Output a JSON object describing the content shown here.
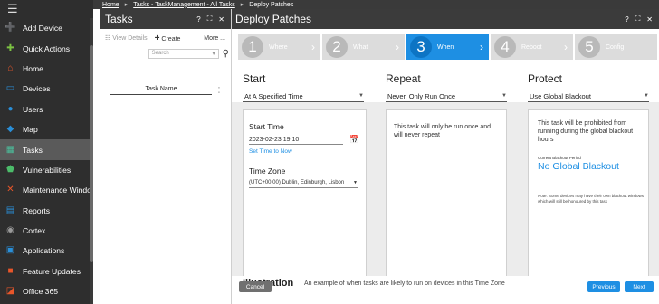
{
  "nav": {
    "items": [
      {
        "label": "Add Device",
        "icon": "add-device-icon",
        "glyph": "➕",
        "color": "#7cc243"
      },
      {
        "label": "Quick Actions",
        "icon": "quick-actions-icon",
        "glyph": "✚",
        "color": "#7cc243"
      },
      {
        "label": "Home",
        "icon": "home-icon",
        "glyph": "⌂",
        "color": "#e8562a"
      },
      {
        "label": "Devices",
        "icon": "devices-icon",
        "glyph": "▭",
        "color": "#2a8fd8"
      },
      {
        "label": "Users",
        "icon": "users-icon",
        "glyph": "●",
        "color": "#2a8fd8"
      },
      {
        "label": "Map",
        "icon": "map-icon",
        "glyph": "◆",
        "color": "#2a8fd8"
      },
      {
        "label": "Tasks",
        "icon": "tasks-icon",
        "glyph": "▦",
        "color": "#4cbc9a"
      },
      {
        "label": "Vulnerabilities",
        "icon": "vulnerabilities-icon",
        "glyph": "⬟",
        "color": "#4cbc6a"
      },
      {
        "label": "Maintenance Windows",
        "icon": "maintenance-icon",
        "glyph": "✕",
        "color": "#e8562a"
      },
      {
        "label": "Reports",
        "icon": "reports-icon",
        "glyph": "▤",
        "color": "#2a8fd8"
      },
      {
        "label": "Cortex",
        "icon": "cortex-icon",
        "glyph": "◉",
        "color": "#9a9a9a"
      },
      {
        "label": "Applications",
        "icon": "applications-icon",
        "glyph": "▣",
        "color": "#2a8fd8"
      },
      {
        "label": "Feature Updates",
        "icon": "feature-updates-icon",
        "glyph": "■",
        "color": "#e8562a"
      },
      {
        "label": "Office 365",
        "icon": "office-icon",
        "glyph": "◪",
        "color": "#e8562a"
      }
    ],
    "active_index": 6
  },
  "breadcrumb": {
    "items": [
      "Home",
      "Tasks - TaskManagement - All Tasks",
      "Deploy Patches"
    ],
    "sep": "▸"
  },
  "tasks_panel": {
    "title": "Tasks",
    "help": "?",
    "view_details": "View Details",
    "create": "Create",
    "more": "More ...",
    "search_placeholder": "Search",
    "column_header": "Task Name"
  },
  "deploy": {
    "title": "Deploy Patches",
    "help": "?",
    "steps": [
      {
        "num": "1",
        "label": "Where"
      },
      {
        "num": "2",
        "label": "What"
      },
      {
        "num": "3",
        "label": "When"
      },
      {
        "num": "4",
        "label": "Reboot"
      },
      {
        "num": "5",
        "label": "Config"
      }
    ],
    "active_step": 2,
    "start": {
      "heading": "Start",
      "dropdown": "At A Specified Time",
      "start_time_label": "Start Time",
      "start_time_value": "2023-02-23 19:10",
      "set_now": "Set Time to Now",
      "timezone_label": "Time Zone",
      "timezone_value": "(UTC+00:00) Dublin, Edinburgh, Lisbon"
    },
    "repeat": {
      "heading": "Repeat",
      "dropdown": "Never, Only Run Once",
      "text": "This task will only be run once and will never repeat"
    },
    "protect": {
      "heading": "Protect",
      "dropdown": "Use Global Blackout",
      "text": "This task will be prohibited from running during the global blackout hours",
      "period_label": "Current Blackout Period",
      "period_value": "No Global Blackout",
      "note": "Note: Some devices may have their own blackout windows which will still be honoured by this task"
    },
    "illustration": "Illustration",
    "illustration_text": "An example of when tasks are likely to run on devices in this Time Zone",
    "buttons": {
      "cancel": "Cancel",
      "previous": "Previous",
      "next": "Next"
    }
  }
}
